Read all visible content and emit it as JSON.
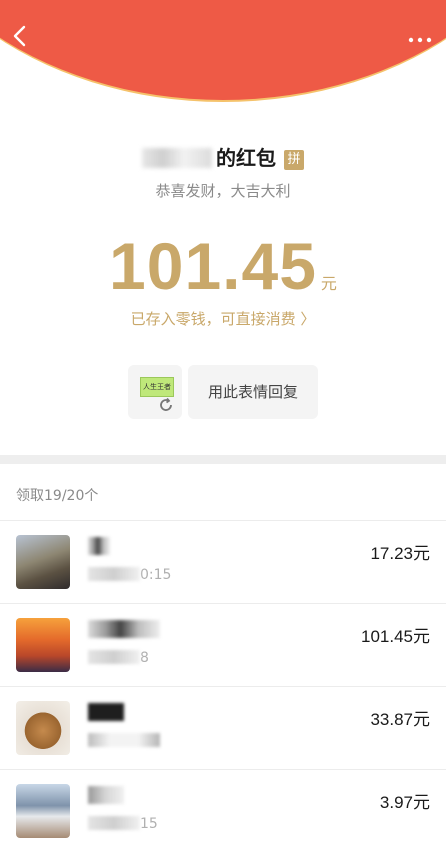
{
  "header": {
    "back_icon": "chevron-left-icon",
    "more_icon": "more-dots-icon"
  },
  "packet": {
    "sender_suffix": "的红包",
    "badge": "拼",
    "wish": "恭喜发财，大吉大利",
    "amount": "101.45",
    "unit": "元",
    "saved_text": "已存入零钱，可直接消费 〉",
    "sticker_text": "人生王者",
    "reply_label": "用此表情回复"
  },
  "summary": {
    "count_text": "领取19/20个"
  },
  "records": [
    {
      "time": "0:15",
      "amount": "17.23元"
    },
    {
      "time": "8",
      "amount": "101.45元"
    },
    {
      "time": "",
      "amount": "33.87元"
    },
    {
      "time": "15",
      "amount": "3.97元"
    }
  ],
  "colors": {
    "header_red": "#ee5a46",
    "gold": "#c9a86a"
  }
}
